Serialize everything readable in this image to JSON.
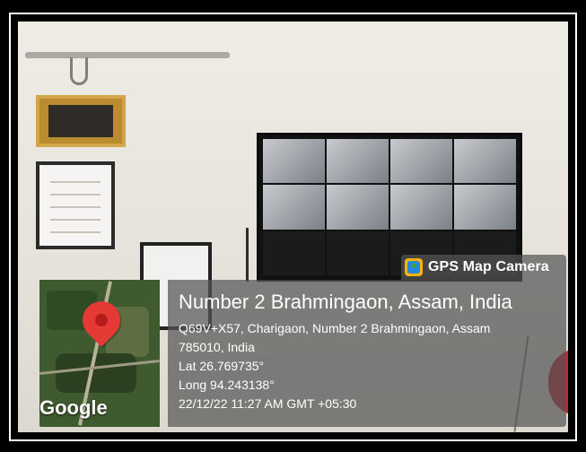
{
  "badge": {
    "icon": "gps-map-camera-icon",
    "label": "GPS Map Camera"
  },
  "map": {
    "brand": "Google",
    "pin_icon": "map-pin-icon"
  },
  "location": {
    "title": "Number 2 Brahmingaon, Assam, India",
    "address_line_1": "Q69V+X57, Charigaon, Number 2 Brahmingaon, Assam",
    "address_line_2": "785010, India",
    "lat": "Lat 26.769735°",
    "long": "Long 94.243138°",
    "datetime": "22/12/22 11:27 AM GMT +05:30"
  },
  "colors": {
    "overlay_bg": "#555555",
    "pin": "#E53935",
    "badge_icon_bg": "#FFB300"
  }
}
